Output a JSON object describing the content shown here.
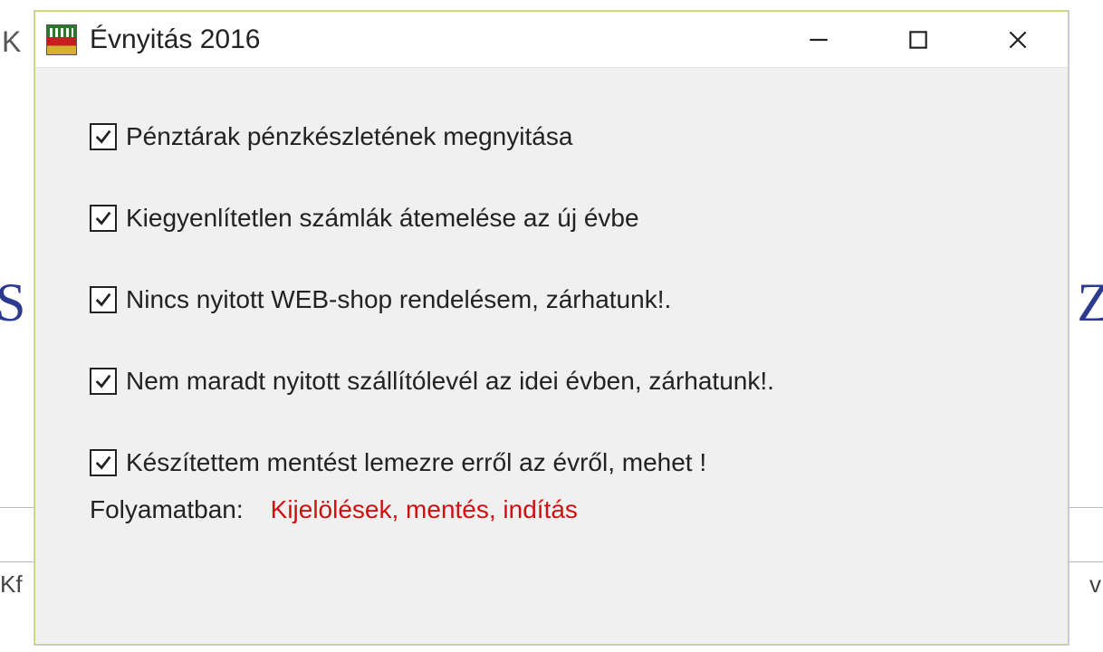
{
  "background": {
    "left_k": "K",
    "left_s": "S",
    "left_kf": "Kf",
    "right_z": "Z",
    "right_v": "v"
  },
  "dialog": {
    "title": "Évnyitás 2016",
    "checks": [
      {
        "label": "Pénztárak pénzkészletének megnyitása",
        "checked": true
      },
      {
        "label": "Kiegyenlítetlen számlák átemelése az új évbe",
        "checked": true
      },
      {
        "label": "Nincs nyitott WEB-shop rendelésem, zárhatunk!.",
        "checked": true
      },
      {
        "label": "Nem maradt nyitott szállítólevél az idei évben, zárhatunk!.",
        "checked": true
      },
      {
        "label": "Készítettem mentést lemezre erről az évről, mehet !",
        "checked": true
      }
    ],
    "status_label": "Folyamatban:",
    "status_value": "Kijelölések, mentés, indítás"
  }
}
